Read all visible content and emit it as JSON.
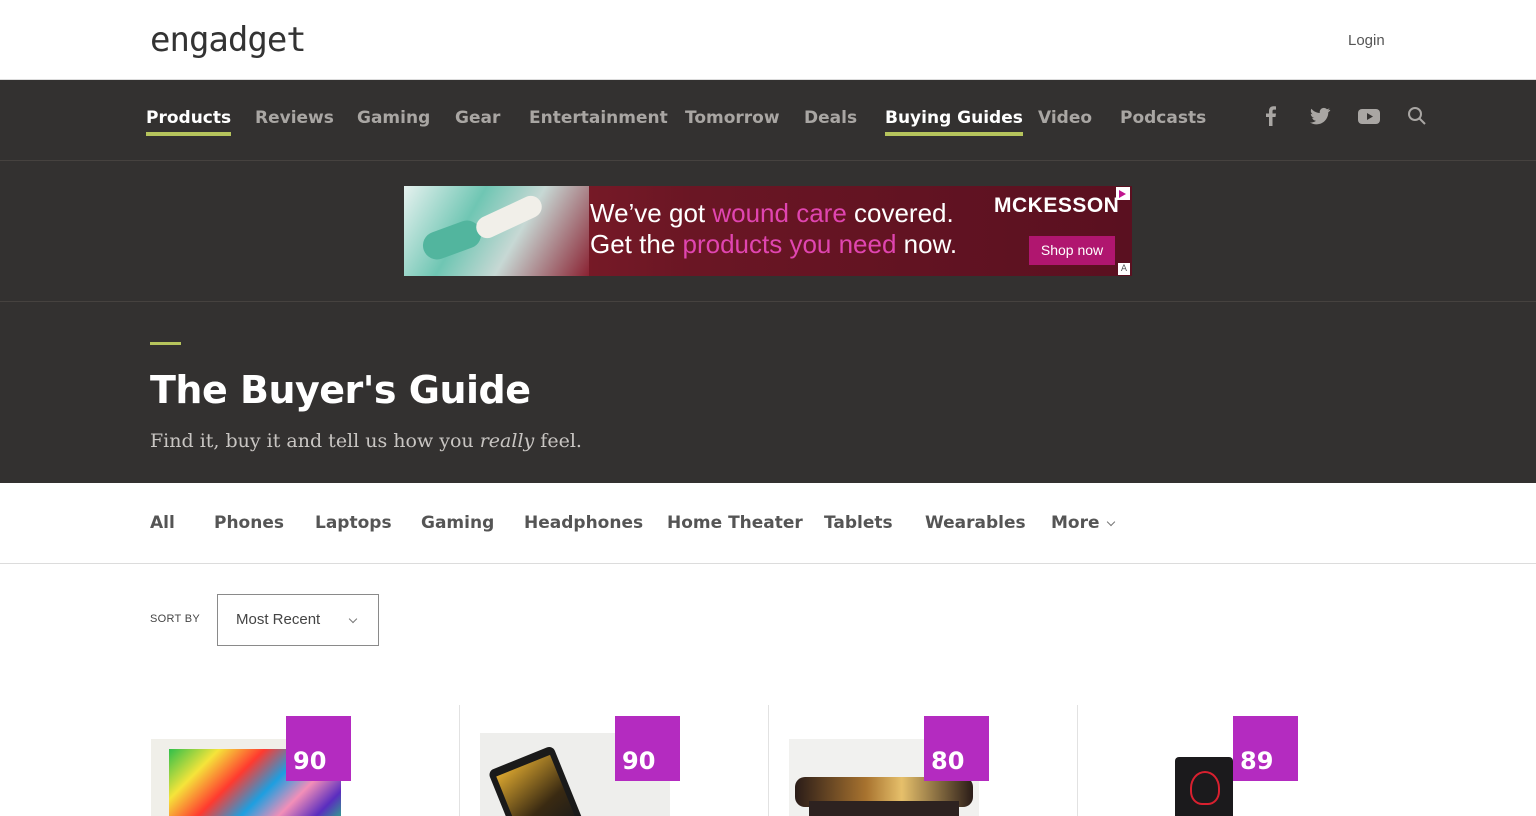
{
  "header": {
    "logo": "engadget",
    "login": "Login"
  },
  "nav": {
    "items": [
      {
        "label": "Products",
        "active": true
      },
      {
        "label": "Reviews",
        "active": false
      },
      {
        "label": "Gaming",
        "active": false
      },
      {
        "label": "Gear",
        "active": false
      },
      {
        "label": "Entertainment",
        "active": false
      },
      {
        "label": "Tomorrow",
        "active": false
      },
      {
        "label": "Deals",
        "active": false
      },
      {
        "label": "Buying Guides",
        "active": true
      },
      {
        "label": "Video",
        "active": false
      },
      {
        "label": "Podcasts",
        "active": false
      }
    ],
    "social_icons": [
      "facebook-icon",
      "twitter-icon",
      "youtube-icon",
      "search-icon"
    ]
  },
  "ad": {
    "line1_pre": "We’ve got ",
    "line1_hl": "wound care",
    "line1_post": " covered.",
    "line2_pre": "Get the ",
    "line2_hl": "products you need",
    "line2_post": " now.",
    "brand": "MCKESSON",
    "cta": "Shop now",
    "badge": "A"
  },
  "hero": {
    "title": "The Buyer's Guide",
    "subtitle_pre": "Find it, buy it and tell us how you ",
    "subtitle_em": "really",
    "subtitle_post": " feel."
  },
  "categories": {
    "items": [
      "All",
      "Phones",
      "Laptops",
      "Gaming",
      "Headphones",
      "Home Theater",
      "Tablets",
      "Wearables",
      "More"
    ]
  },
  "sort": {
    "label": "SORT BY",
    "value": "Most Recent"
  },
  "products": [
    {
      "score": "90"
    },
    {
      "score": "90"
    },
    {
      "score": "80"
    },
    {
      "score": "89"
    }
  ],
  "colors": {
    "nav_bg": "#333130",
    "accent": "#b6c45c",
    "score_bg": "#b42bc0",
    "ad_cta": "#b0166f"
  }
}
